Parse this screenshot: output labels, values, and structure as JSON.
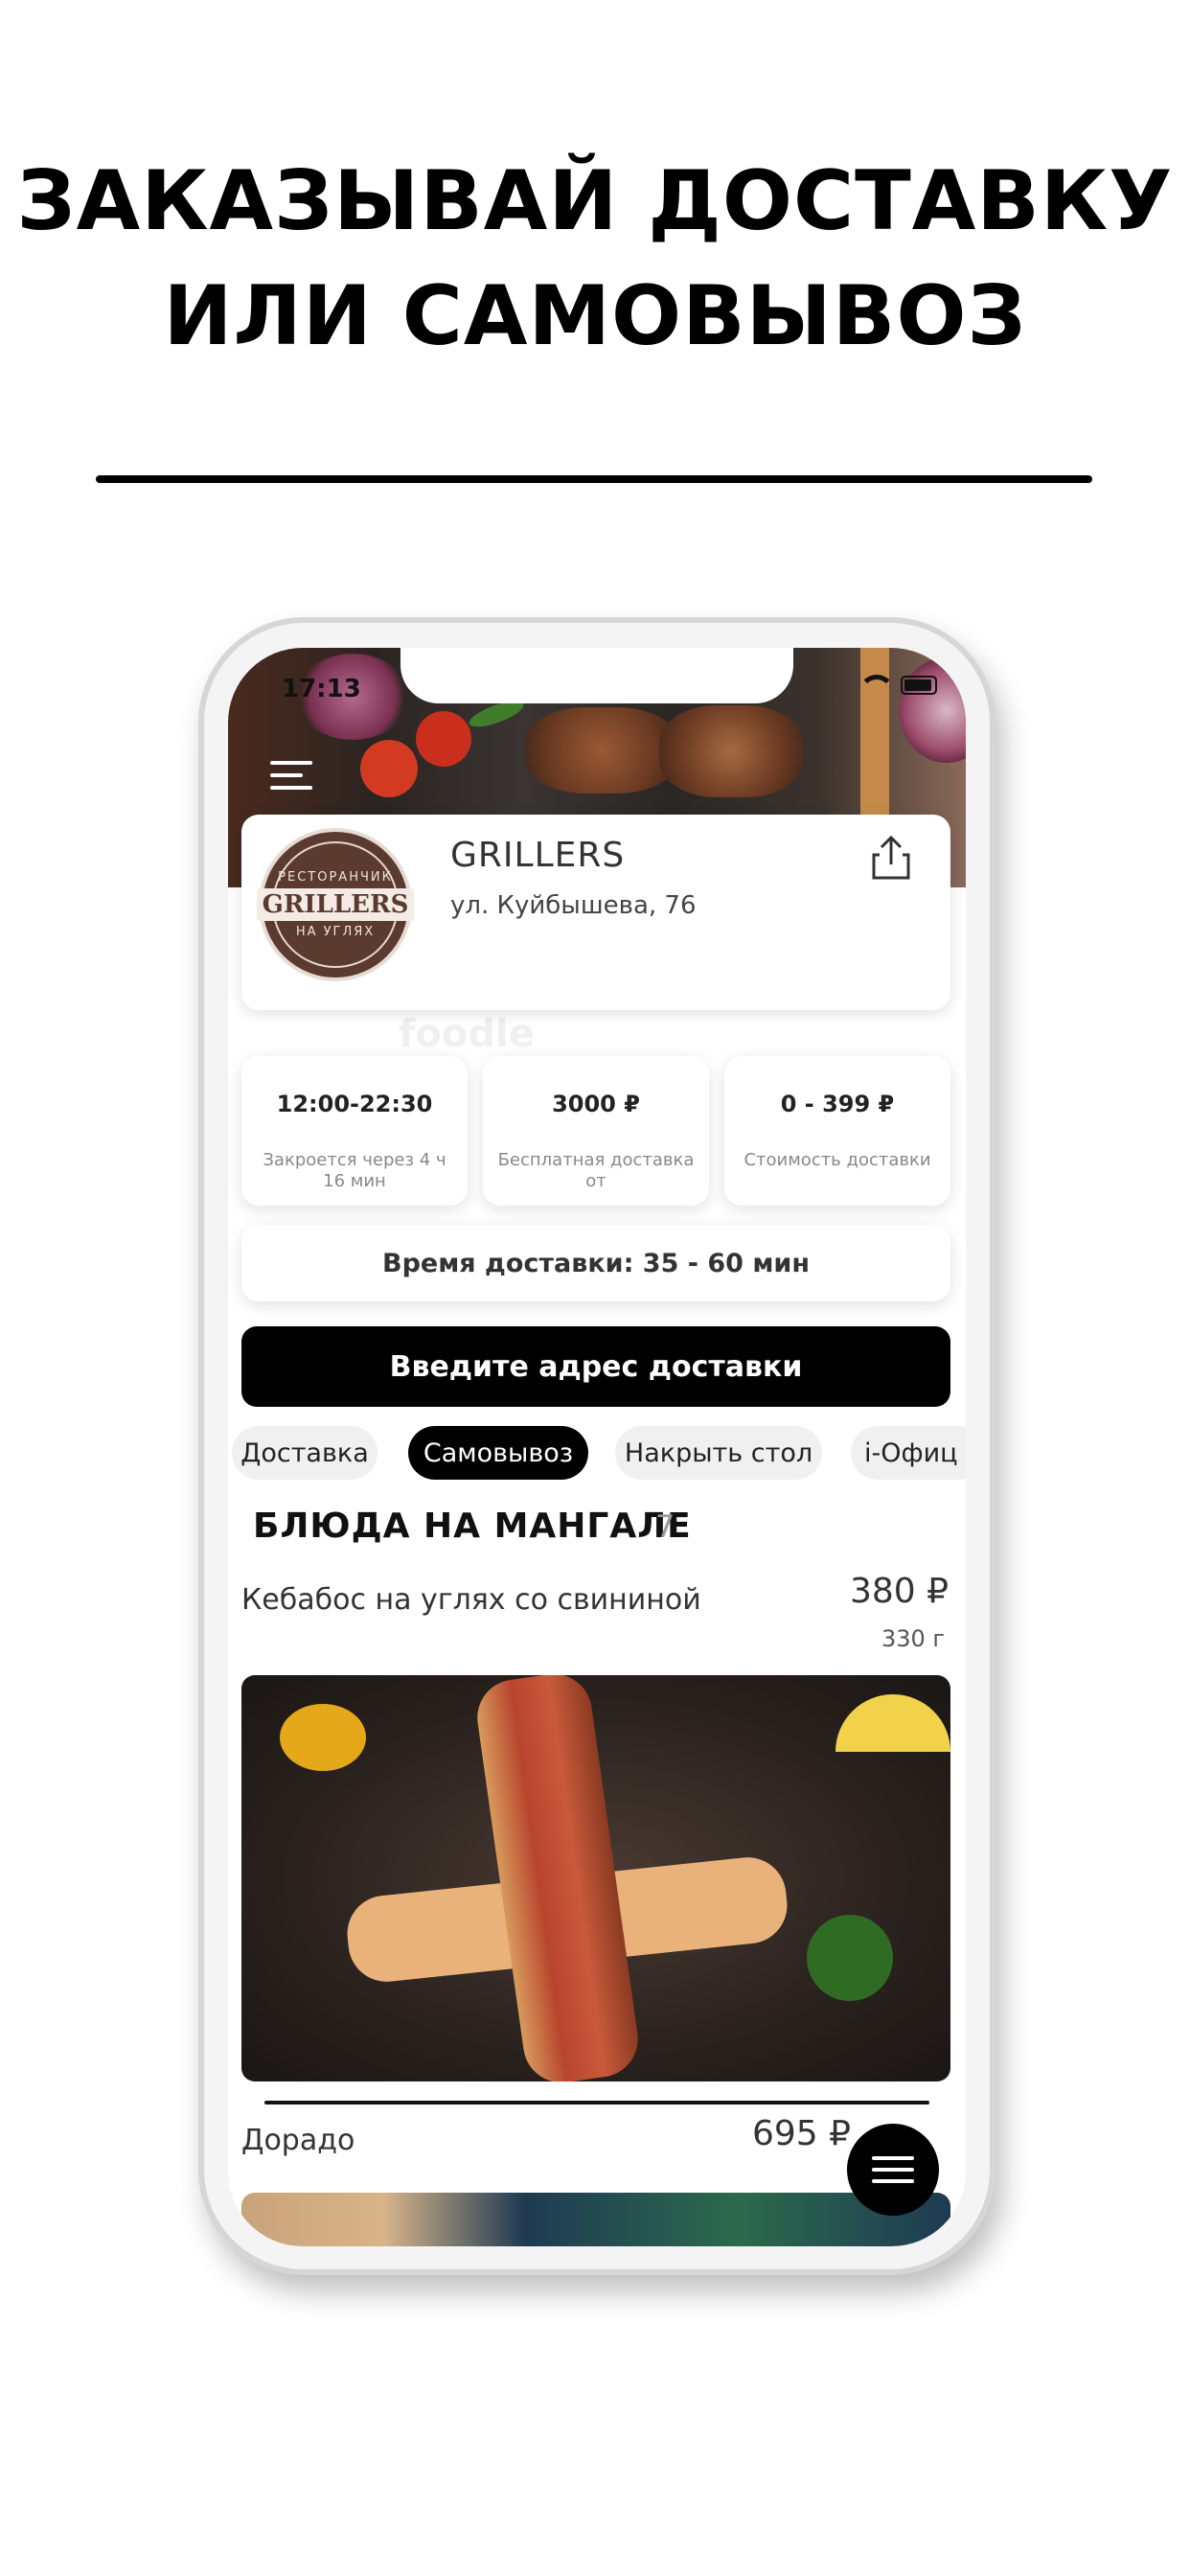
{
  "headline": {
    "line1": "ЗАКАЗЫВАЙ ДОСТАВКУ",
    "line2": "ИЛИ САМОВЫВОЗ"
  },
  "status_bar": {
    "time": "17:13"
  },
  "restaurant": {
    "name": "GRILLERS",
    "address": "ул. Куйбышева, 76",
    "logo": {
      "top_text": "РЕСТОРАНЧИК",
      "brand": "GRILLERS",
      "bottom_text": "НА УГЛЯХ"
    }
  },
  "stats": [
    {
      "value": "12:00-22:30",
      "label": "Закроется через 4 ч 16 мин"
    },
    {
      "value": "3000 ₽",
      "label": "Бесплатная доставка от"
    },
    {
      "value": "0 - 399 ₽",
      "label": "Стоимость доставки"
    }
  ],
  "delivery_time": "Время доставки: 35 - 60 мин",
  "address_button": "Введите адрес доставки",
  "tabs": [
    {
      "label": "Доставка",
      "active": false
    },
    {
      "label": "Самовывоз",
      "active": true
    },
    {
      "label": "Накрыть стол",
      "active": false
    },
    {
      "label": "i-Офиц",
      "active": false
    }
  ],
  "section": {
    "title": "БЛЮДА НА МАНГАЛЕ",
    "count": "7"
  },
  "items": [
    {
      "name": "Кебабос на углях со свининой",
      "price": "380 ₽",
      "weight": "330 г"
    },
    {
      "name": "Дорадо",
      "price": "695 ₽"
    }
  ],
  "watermark": "foodle",
  "colors": {
    "accent": "#000000",
    "background": "#ffffff",
    "logo_brown": "#5b3a2f"
  }
}
